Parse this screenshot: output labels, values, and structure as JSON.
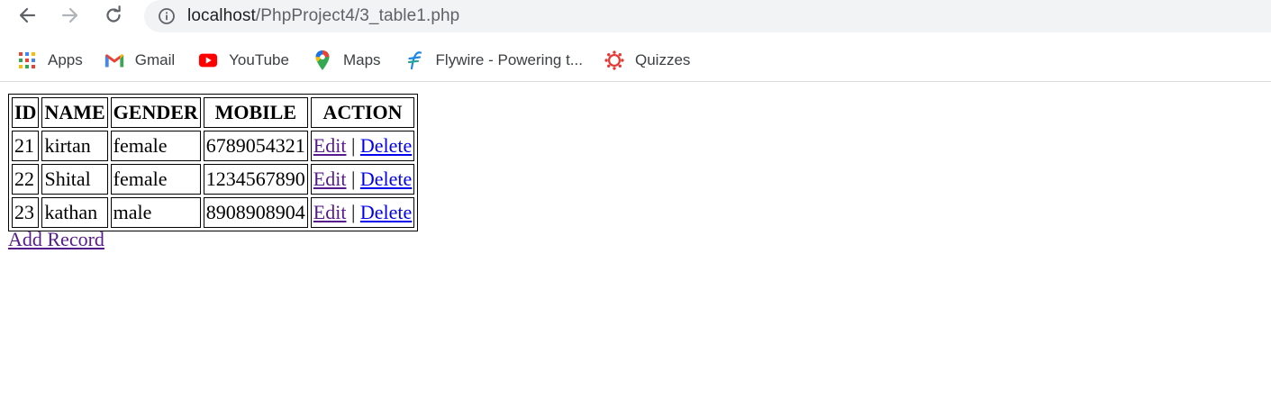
{
  "browser": {
    "url_host": "localhost",
    "url_path": "/PhpProject4/3_table1.php"
  },
  "bookmarks": [
    {
      "label": "Apps",
      "icon": "apps-grid-icon"
    },
    {
      "label": "Gmail",
      "icon": "gmail-icon"
    },
    {
      "label": "YouTube",
      "icon": "youtube-icon"
    },
    {
      "label": "Maps",
      "icon": "maps-pin-icon"
    },
    {
      "label": "Flywire - Powering t...",
      "icon": "flywire-icon"
    },
    {
      "label": "Quizzes",
      "icon": "quizzes-icon"
    }
  ],
  "table": {
    "headers": [
      "ID",
      "NAME",
      "GENDER",
      "MOBILE",
      "ACTION"
    ],
    "rows": [
      {
        "id": "21",
        "name": "kirtan",
        "gender": "female",
        "mobile": "6789054321"
      },
      {
        "id": "22",
        "name": "Shital",
        "gender": "female",
        "mobile": "1234567890"
      },
      {
        "id": "23",
        "name": "kathan",
        "gender": "male",
        "mobile": "8908908904"
      }
    ],
    "edit_label": "Edit",
    "separator": "|",
    "delete_label": "Delete"
  },
  "add_record_label": "Add Record",
  "colors": {
    "visited_link": "#551a8b",
    "link": "#0000ee",
    "omnibox_bg": "#f1f3f4"
  }
}
